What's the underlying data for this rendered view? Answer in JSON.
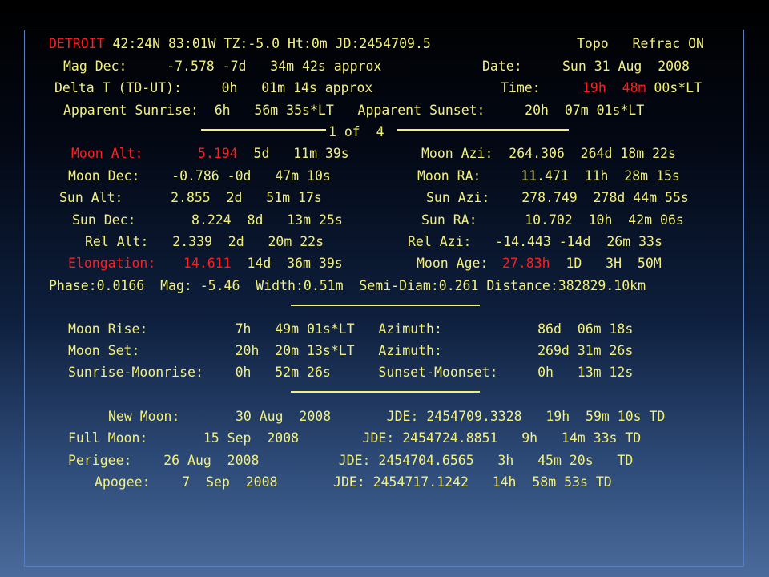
{
  "header": {
    "city": "DETROIT",
    "location": " 42:24N 83:01W TZ:-5.0 Ht:0m JD:2454709.5",
    "mode": "Topo   Refrac ON"
  },
  "info": {
    "mag_dec": "Mag Dec:     -7.578 -7d   34m 42s approx",
    "date_label": "Date:",
    "date_value": "Sun 31 Aug  2008",
    "delta_t": "Delta T (TD-UT):     0h   01m 14s approx",
    "time_label": "Time:",
    "time_value": "19h  48m",
    "time_suffix": " 00s*LT",
    "sun_times": "Apparent Sunrise:  6h   56m 35s*LT   Apparent Sunset:     20h  07m 01s*LT"
  },
  "page_indicator": "1 of  4",
  "moon_alt": {
    "label": "Moon Alt:",
    "deg": "5.194",
    "dms": "  5d   11m 39s"
  },
  "moon_azi": "Moon Azi:  264.306  264d 18m 22s",
  "rows": {
    "moon_dec": "Moon Dec:    -0.786 -0d   47m 10s",
    "moon_ra": "Moon RA:     11.471  11h  28m 15s",
    "sun_alt": "Sun Alt:      2.855  2d   51m 17s",
    "sun_azi": "Sun Azi:    278.749  278d 44m 55s",
    "sun_dec": "Sun Dec:       8.224  8d   13m 25s",
    "sun_ra": "Sun RA:      10.702  10h  42m 06s",
    "rel_alt": "Rel Alt:   2.339  2d   20m 22s",
    "rel_azi": "Rel Azi:   -14.443 -14d  26m 33s"
  },
  "elongation": {
    "label": "Elongation:",
    "value": "14.611",
    "dms": "  14d  36m 39s"
  },
  "moon_age": {
    "label": "Moon Age:",
    "value": "27.83h",
    "dhm": "  1D   3H  50M"
  },
  "phase_line": "Phase:0.0166  Mag: -5.46  Width:0.51m  Semi-Diam:0.261 Distance:382829.10km",
  "rise_set": {
    "moon_rise": "Moon Rise:           7h   49m 01s*LT   Azimuth:            86d  06m 18s",
    "moon_set": "Moon Set:            20h  20m 13s*LT   Azimuth:            269d 31m 26s",
    "sun_moon_rise": "Sunrise-Moonrise:    0h   52m 26s      Sunset-Moonset:     0h   13m 12s"
  },
  "phases": {
    "new_moon": "New Moon:       30 Aug  2008       JDE: 2454709.3328   19h  59m 10s TD",
    "full_moon": "Full Moon:       15 Sep  2008        JDE: 2454724.8851   9h   14m 33s TD",
    "perigee": "Perigee:    26 Aug  2008          JDE: 2454704.6565   3h   45m 20s   TD",
    "apogee": "Apogee:    7  Sep  2008       JDE: 2454717.1242   14h  58m 53s TD"
  }
}
